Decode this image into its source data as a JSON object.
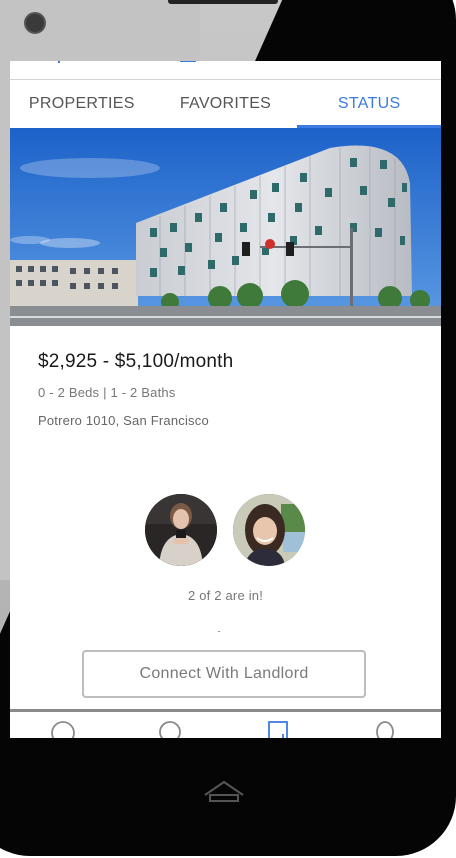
{
  "tabs": [
    {
      "label": "PROPERTIES",
      "active": false
    },
    {
      "label": "FAVORITES",
      "active": false
    },
    {
      "label": "STATUS",
      "active": true
    }
  ],
  "colors": {
    "accent": "#3b7be0",
    "text_muted": "#777777"
  },
  "listing": {
    "price": "$2,925 - $5,100/month",
    "details": "0 - 2 Beds | 1 - 2 Baths",
    "address": "Potrero 1010, San Francisco"
  },
  "roommates": {
    "status": "2 of 2 are in!"
  },
  "actions": {
    "connect_label": "Connect With Landlord"
  },
  "bottom_nav": [
    {
      "icon": "circle-icon",
      "active": false
    },
    {
      "icon": "search-icon",
      "active": false
    },
    {
      "icon": "bookmark-icon",
      "active": true
    },
    {
      "icon": "person-icon",
      "active": false
    }
  ]
}
